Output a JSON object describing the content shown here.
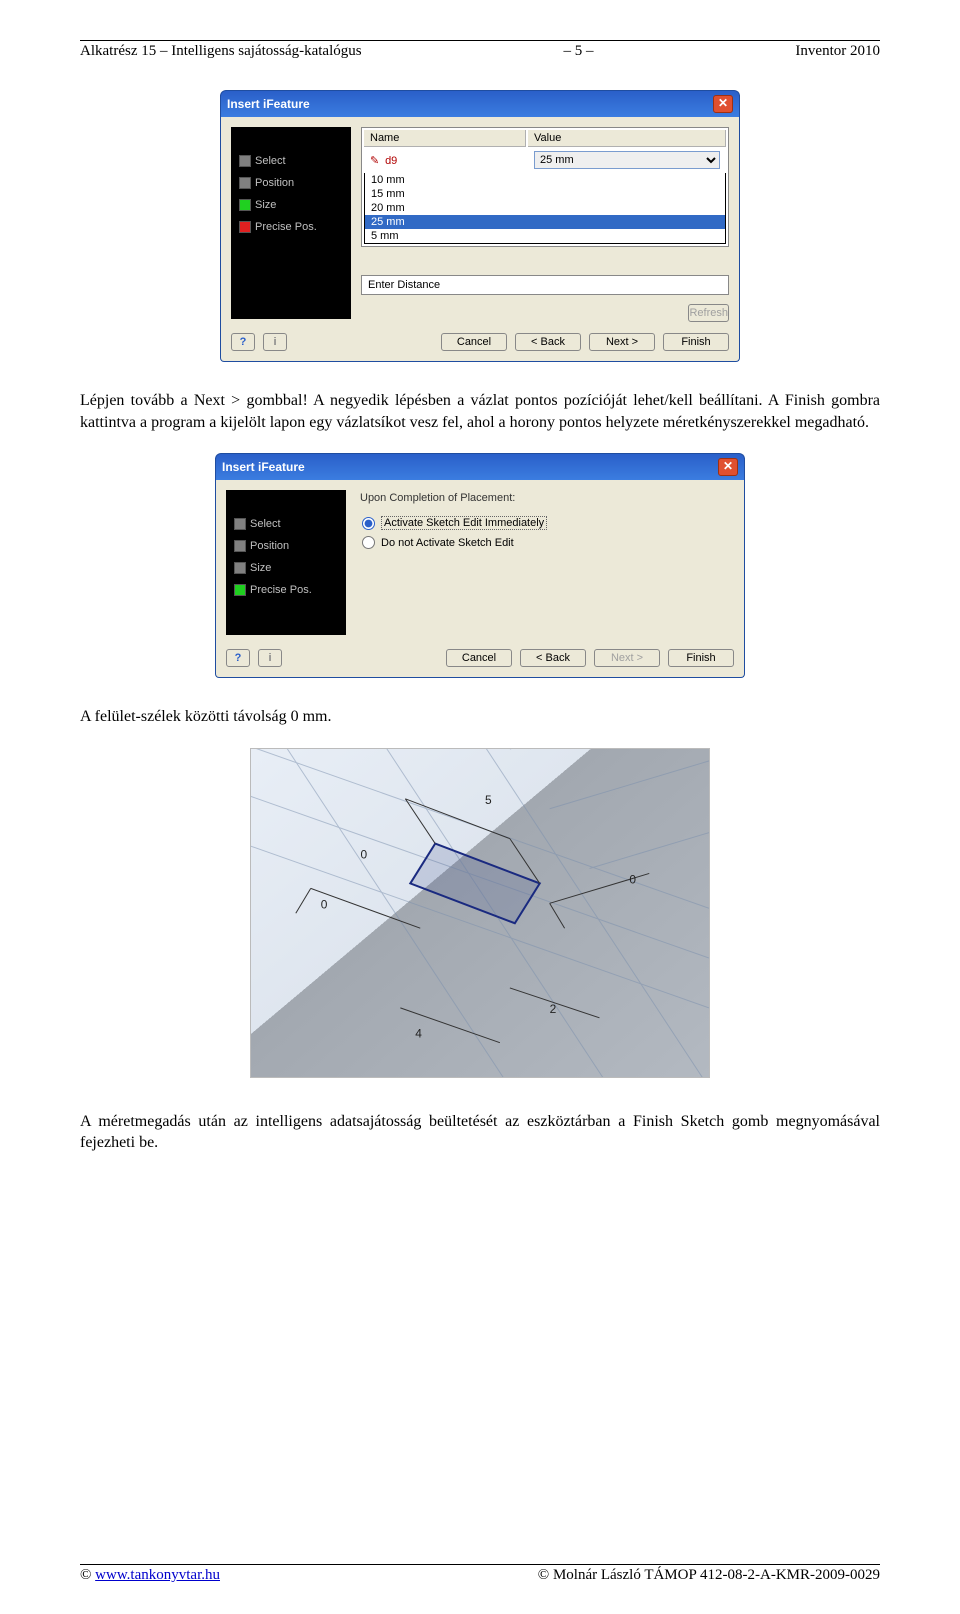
{
  "header": {
    "left": "Alkatrész 15 – Intelligens sajátosság-katalógus",
    "center": "– 5 –",
    "right": "Inventor 2010"
  },
  "dialog1": {
    "title": "Insert iFeature",
    "steps": [
      "Select",
      "Position",
      "Size",
      "Precise Pos."
    ],
    "col_name": "Name",
    "col_value": "Value",
    "row_name": "d9",
    "row_value": "25 mm",
    "options": [
      "10 mm",
      "15 mm",
      "20 mm",
      "25 mm",
      "5 mm"
    ],
    "input_label": "Enter Distance",
    "refresh": "Refresh",
    "cancel": "Cancel",
    "back": "< Back",
    "next": "Next >",
    "finish": "Finish"
  },
  "para1": "Lépjen tovább a Next > gombbal! A negyedik lépésben a vázlat pontos pozícióját lehet/kell beállítani. A Finish gombra kattintva a program a kijelölt lapon egy vázlatsíkot vesz fel, ahol a horony pontos helyzete méretkényszerekkel megadható.",
  "dialog2": {
    "title": "Insert iFeature",
    "steps": [
      "Select",
      "Position",
      "Size",
      "Precise Pos."
    ],
    "group": "Upon Completion of Placement:",
    "opt1": "Activate Sketch Edit Immediately",
    "opt2": "Do not Activate Sketch Edit",
    "cancel": "Cancel",
    "back": "< Back",
    "next": "Next >",
    "finish": "Finish"
  },
  "para2": "A felület-szélek közötti távolság 0 mm.",
  "sketch_dims": [
    "5",
    "0",
    "0",
    "0",
    "4",
    "2"
  ],
  "para3": "A méretmegadás után az intelligens adatsajátosság beültetését az eszköztárban a Finish Sketch gomb megnyomásával fejezheti be.",
  "footer": {
    "left_sym": "©",
    "left_link": "www.tankonyvtar.hu",
    "right": "© Molnár László TÁMOP 412-08-2-A-KMR-2009-0029"
  }
}
